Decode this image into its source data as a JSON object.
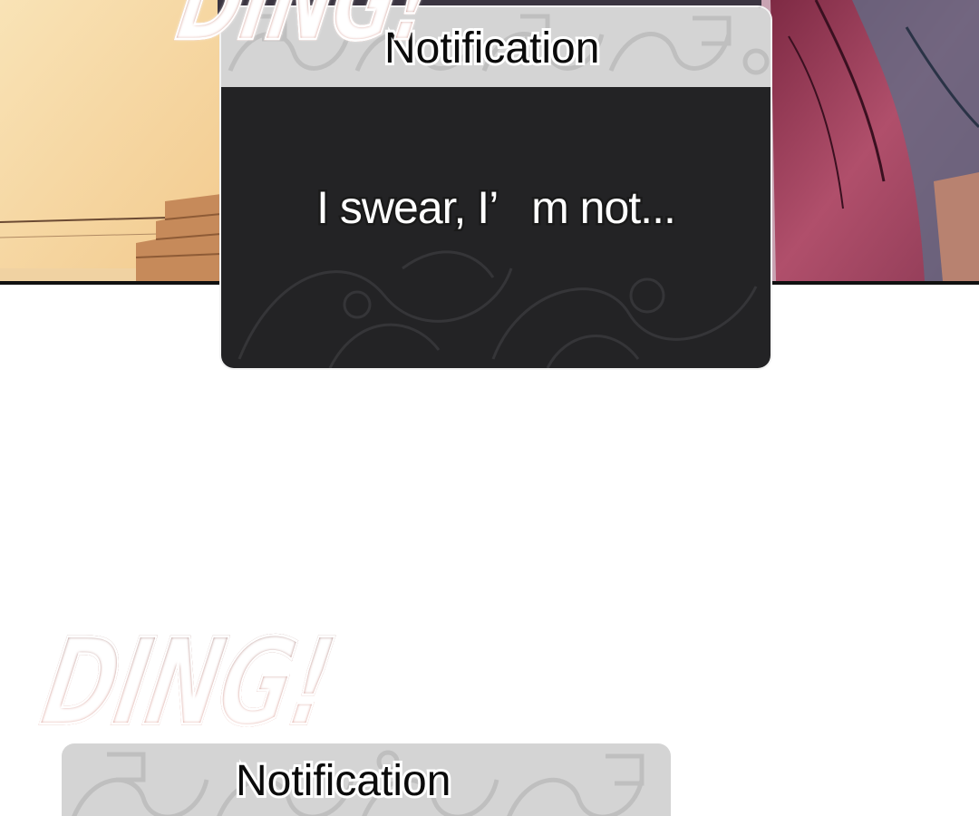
{
  "sfx": {
    "top": "DING!",
    "bottom": "DING!"
  },
  "notification_top": {
    "title": "Notification",
    "message": "I swear, I’   m not..."
  },
  "notification_bottom": {
    "title": "Notification"
  },
  "colors": {
    "panel_left": "#f7dcab",
    "panel_right": "#a8455f",
    "card_header": "#d4d4d4",
    "card_body": "#232325",
    "sfx_red": "#b33222"
  }
}
